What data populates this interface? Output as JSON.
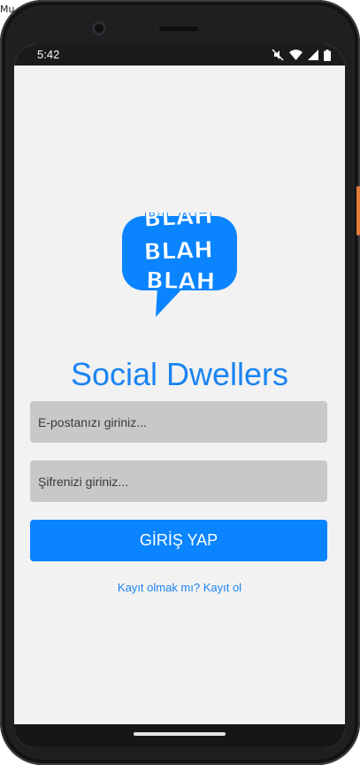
{
  "window": {
    "corner_label": "Mu"
  },
  "status_bar": {
    "time": "5:42",
    "icons": [
      "mute-icon",
      "wifi-icon",
      "signal-icon",
      "battery-icon"
    ]
  },
  "logo": {
    "lines": [
      "BLAH",
      "BLAH",
      "BLAH"
    ]
  },
  "app": {
    "title": "Social Dwellers"
  },
  "form": {
    "email_placeholder": "E-postanızı giriniz...",
    "password_placeholder": "Şifrenizi giriniz...",
    "login_label": "GİRİŞ YAP",
    "register_link": "Kayıt olmak mı? Kayıt ol"
  },
  "colors": {
    "accent": "#0A84FF",
    "title": "#1A84F2",
    "field_background": "#C8C8CB",
    "screen_background": "#F2F2F2"
  }
}
